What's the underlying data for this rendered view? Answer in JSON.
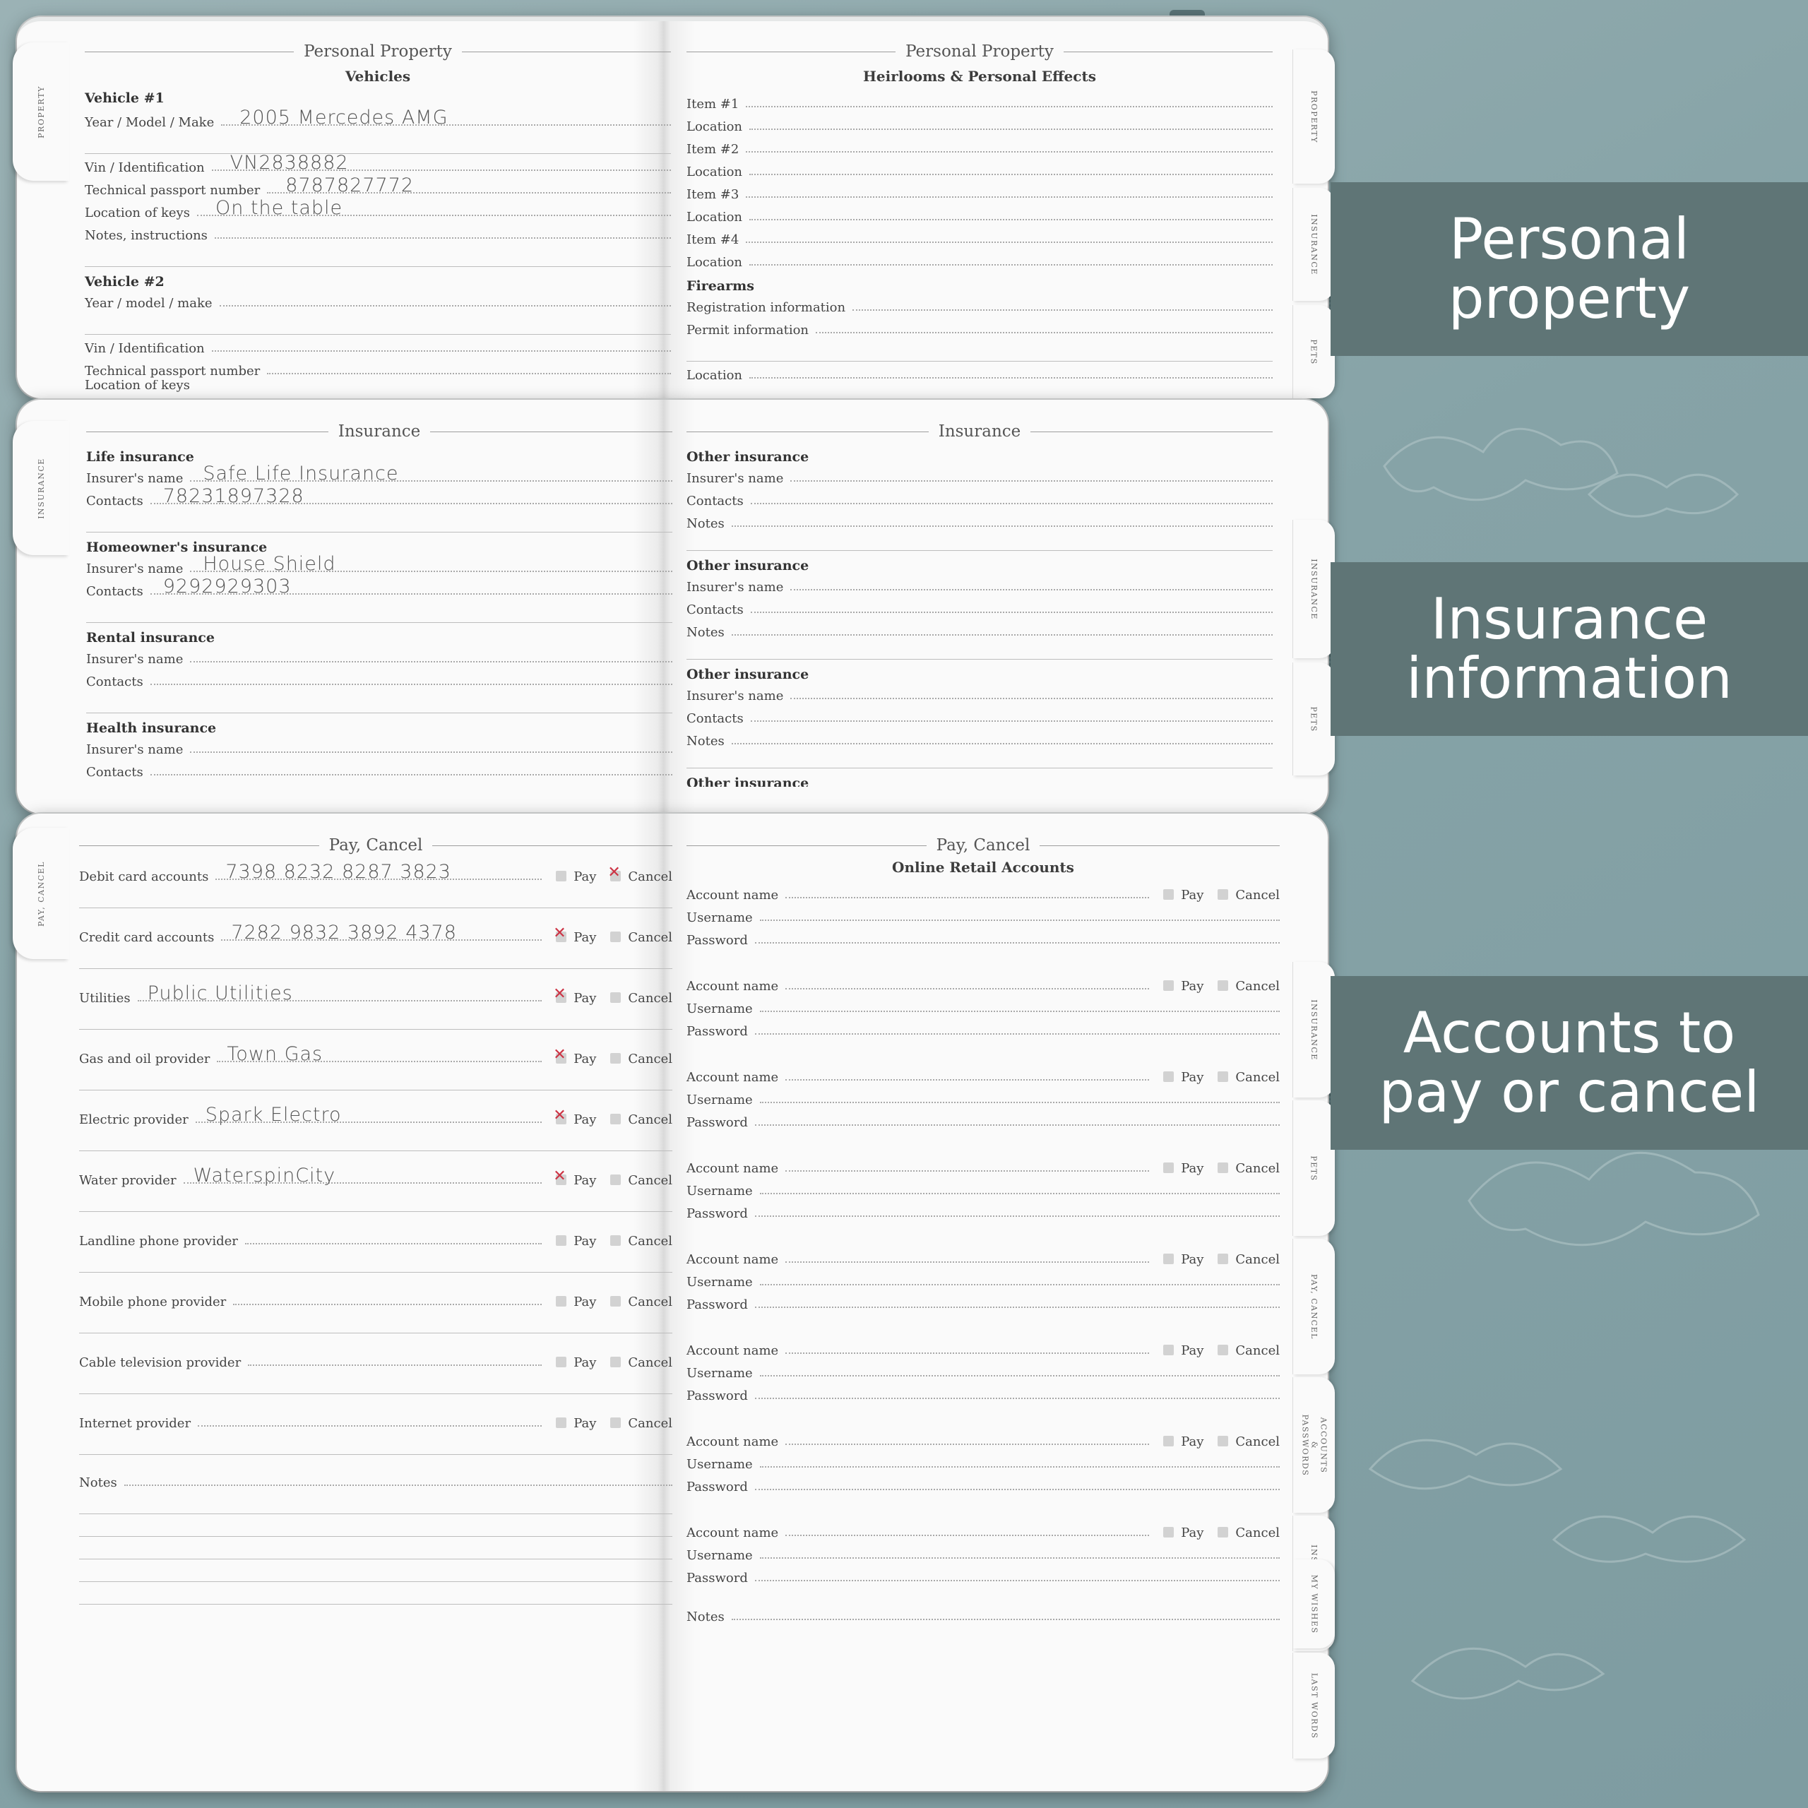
{
  "banners": {
    "property": [
      "Personal",
      "property"
    ],
    "insurance": [
      "Insurance",
      "information"
    ],
    "accounts": [
      "Accounts to",
      "pay or cancel"
    ]
  },
  "book1": {
    "left_tab": "PROPERTY",
    "right_tabs": [
      "PROPERTY",
      "INSURANCE",
      "PETS"
    ],
    "left": {
      "title": "Personal Property",
      "subtitle": "Vehicles",
      "vehicle1": {
        "heading": "Vehicle #1",
        "year_label": "Year / Model / Make",
        "year_value": "2005 Mercedes AMG",
        "vin_label": "Vin / Identification",
        "vin_value": "VN2838882",
        "passport_label": "Technical passport number",
        "passport_value": "8787827772",
        "keys_label": "Location of keys",
        "keys_value": "On the table",
        "notes_label": "Notes, instructions"
      },
      "vehicle2": {
        "heading": "Vehicle #2",
        "year_label": "Year / model / make",
        "vin_label": "Vin / Identification",
        "passport_label": "Technical passport number",
        "keys_label": "Location of keys"
      }
    },
    "right": {
      "title": "Personal Property",
      "subtitle": "Heirlooms & Personal Effects",
      "items": [
        {
          "item": "Item #1",
          "loc": "Location"
        },
        {
          "item": "Item #2",
          "loc": "Location"
        },
        {
          "item": "Item #3",
          "loc": "Location"
        },
        {
          "item": "Item #4",
          "loc": "Location"
        }
      ],
      "firearms": {
        "heading": "Firearms",
        "reg_label": "Registration information",
        "permit_label": "Permit information",
        "loc_label": "Location"
      }
    }
  },
  "book2": {
    "left_tab": "INSURANCE",
    "right_tabs": [
      "INSURANCE",
      "PETS"
    ],
    "left": {
      "title": "Insurance",
      "groups": [
        {
          "heading": "Life insurance",
          "insurer_label": "Insurer's name",
          "insurer_value": "Safe Life Insurance",
          "contacts_label": "Contacts",
          "contacts_value": "78231897328"
        },
        {
          "heading": "Homeowner's insurance",
          "insurer_label": "Insurer's name",
          "insurer_value": "House Shield",
          "contacts_label": "Contacts",
          "contacts_value": "9292929303"
        },
        {
          "heading": "Rental insurance",
          "insurer_label": "Insurer's name",
          "contacts_label": "Contacts"
        },
        {
          "heading": "Health insurance",
          "insurer_label": "Insurer's name",
          "contacts_label": "Contacts"
        }
      ]
    },
    "right": {
      "title": "Insurance",
      "groups": [
        {
          "heading": "Other insurance",
          "insurer_label": "Insurer's name",
          "contacts_label": "Contacts",
          "notes_label": "Notes"
        },
        {
          "heading": "Other insurance",
          "insurer_label": "Insurer's name",
          "contacts_label": "Contacts",
          "notes_label": "Notes"
        },
        {
          "heading": "Other insurance",
          "insurer_label": "Insurer's name",
          "contacts_label": "Contacts",
          "notes_label": "Notes"
        }
      ],
      "last_heading": "Other insurance"
    }
  },
  "book3": {
    "left_tab": "PAY, CANCEL",
    "right_tabs": [
      "INSURANCE",
      "PETS",
      "PAY, CANCEL",
      "ACCOUNTS & PASSWORDS",
      "INSTRUCTIONS",
      "MY WISHES",
      "LAST WORDS"
    ],
    "pay_label": "Pay",
    "cancel_label": "Cancel",
    "left": {
      "title": "Pay, Cancel",
      "rows": [
        {
          "label": "Debit card accounts",
          "value": "7398 8232 8287 3823",
          "pay": false,
          "cancel": true
        },
        {
          "label": "Credit card accounts",
          "value": "7282 9832 3892 4378",
          "pay": true,
          "cancel": false
        },
        {
          "label": "Utilities",
          "value": "Public Utilities",
          "pay": true,
          "cancel": false
        },
        {
          "label": "Gas and oil provider",
          "value": "Town Gas",
          "pay": true,
          "cancel": false
        },
        {
          "label": "Electric provider",
          "value": "Spark Electro",
          "pay": true,
          "cancel": false
        },
        {
          "label": "Water provider",
          "value": "WaterspinCity",
          "pay": true,
          "cancel": false
        },
        {
          "label": "Landline phone provider",
          "value": "",
          "pay": false,
          "cancel": false
        },
        {
          "label": "Mobile phone provider",
          "value": "",
          "pay": false,
          "cancel": false
        },
        {
          "label": "Cable television provider",
          "value": "",
          "pay": false,
          "cancel": false
        },
        {
          "label": "Internet provider",
          "value": "",
          "pay": false,
          "cancel": false
        }
      ],
      "notes_label": "Notes"
    },
    "right": {
      "title": "Pay, Cancel",
      "subtitle": "Online Retail Accounts",
      "account_label": "Account name",
      "username_label": "Username",
      "password_label": "Password",
      "account_count": 8,
      "notes_label": "Notes"
    }
  }
}
